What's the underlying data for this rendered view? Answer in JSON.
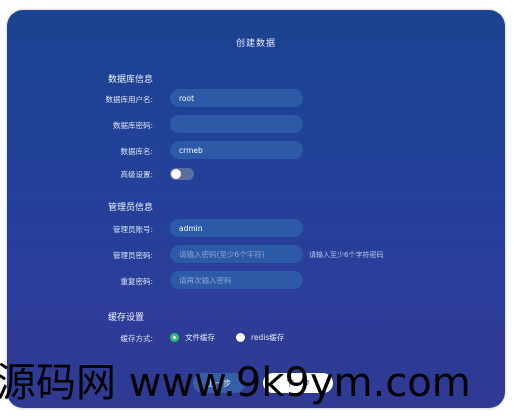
{
  "title": "创建数据",
  "database": {
    "heading": "数据库信息",
    "username_label": "数据库用户名:",
    "username_value": "root",
    "password_label": "数据库密码:",
    "password_value": "",
    "dbname_label": "数据库名:",
    "dbname_value": "crmeb",
    "advanced_label": "高级设置:",
    "advanced_enabled": false
  },
  "admin": {
    "heading": "管理员信息",
    "account_label": "管理员账号:",
    "account_value": "admin",
    "password_label": "管理员密码:",
    "password_placeholder": "请输入密码(至少6个字符)",
    "password_hint": "请输入至少6个字符密码",
    "confirm_label": "重复密码:",
    "confirm_placeholder": "请再次输入密码"
  },
  "cache": {
    "heading": "缓存设置",
    "mode_label": "缓存方式:",
    "options": [
      "文件缓存",
      "redis缓存"
    ],
    "selected": "文件缓存"
  },
  "buttons": {
    "prev": "上一步",
    "next": "下一步"
  },
  "watermark": "源码网 www.9k9ym.com",
  "colors": {
    "background_top": "#1b4391",
    "background_bottom": "#2f3a93",
    "input_bg": "#2c5aa6",
    "radio_checked": "#2fbf71"
  }
}
